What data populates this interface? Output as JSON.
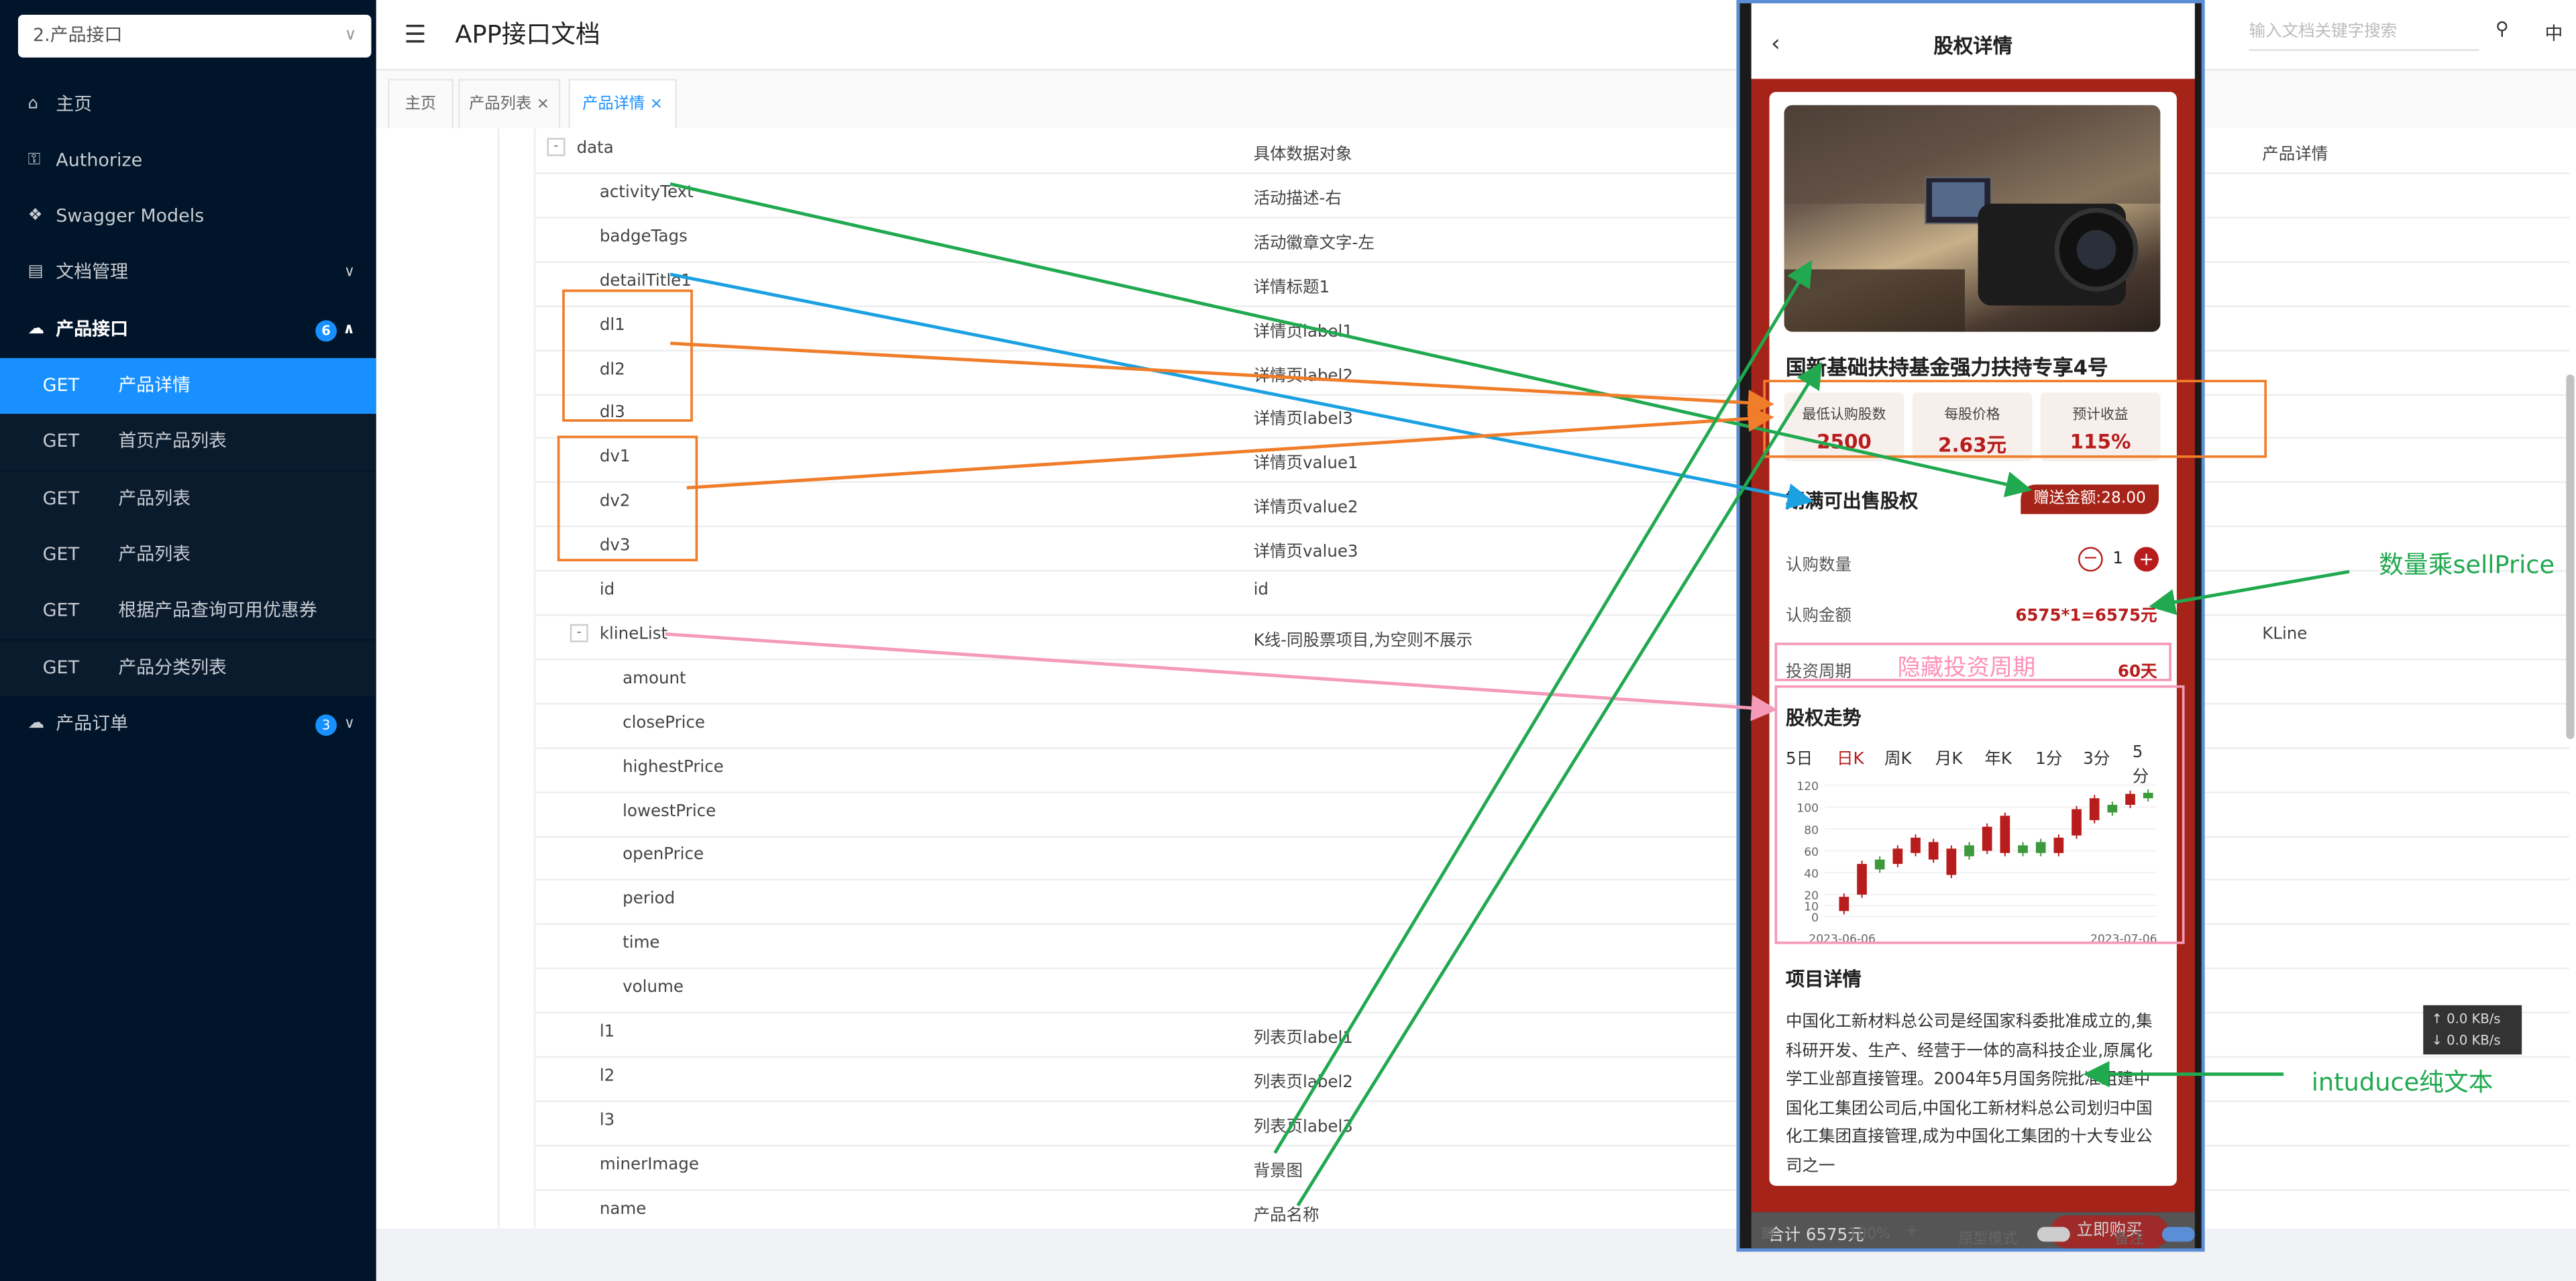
{
  "sidebar": {
    "select_value": "2.产品接口",
    "items": [
      {
        "icon": "home-icon",
        "glyph": "⌂",
        "label": "主页"
      },
      {
        "icon": "lock-icon",
        "glyph": "⚿",
        "label": "Authorize"
      },
      {
        "icon": "cube-icon",
        "glyph": "❖",
        "label": "Swagger Models"
      },
      {
        "icon": "doc-icon",
        "glyph": "▤",
        "label": "文档管理"
      }
    ],
    "group_products": {
      "label": "产品接口",
      "badge": "6"
    },
    "endpoints": [
      {
        "method": "GET",
        "label": "产品详情"
      },
      {
        "method": "GET",
        "label": "首页产品列表"
      },
      {
        "method": "GET",
        "label": "产品列表"
      },
      {
        "method": "GET",
        "label": "产品列表"
      },
      {
        "method": "GET",
        "label": "根据产品查询可用优惠券"
      },
      {
        "method": "GET",
        "label": "产品分类列表"
      }
    ],
    "group_orders": {
      "label": "产品订单",
      "badge": "3"
    }
  },
  "header": {
    "title": "APP接口文档",
    "search_placeholder": "输入文档关键字搜索",
    "lang": "中"
  },
  "tabs": [
    "主页",
    "产品列表",
    "产品详情"
  ],
  "table": {
    "extra_data": "产品详情",
    "extra_kline": "KLine",
    "rows": [
      {
        "name": "data",
        "desc": "具体数据对象",
        "indent": 0
      },
      {
        "name": "activityText",
        "desc": "活动描述-右",
        "indent": 1
      },
      {
        "name": "badgeTags",
        "desc": "活动徽章文字-左",
        "indent": 1
      },
      {
        "name": "detailTitle1",
        "desc": "详情标题1",
        "indent": 1
      },
      {
        "name": "dl1",
        "desc": "详情页label1",
        "indent": 1
      },
      {
        "name": "dl2",
        "desc": "详情页label2",
        "indent": 1
      },
      {
        "name": "dl3",
        "desc": "详情页label3",
        "indent": 1
      },
      {
        "name": "dv1",
        "desc": "详情页value1",
        "indent": 1
      },
      {
        "name": "dv2",
        "desc": "详情页value2",
        "indent": 1
      },
      {
        "name": "dv3",
        "desc": "详情页value3",
        "indent": 1
      },
      {
        "name": "id",
        "desc": "id",
        "indent": 1
      },
      {
        "name": "klineList",
        "desc": "K线-同股票项目,为空则不展示",
        "indent": 1
      },
      {
        "name": "amount",
        "desc": "",
        "indent": 2
      },
      {
        "name": "closePrice",
        "desc": "",
        "indent": 2
      },
      {
        "name": "highestPrice",
        "desc": "",
        "indent": 2
      },
      {
        "name": "lowestPrice",
        "desc": "",
        "indent": 2
      },
      {
        "name": "openPrice",
        "desc": "",
        "indent": 2
      },
      {
        "name": "period",
        "desc": "",
        "indent": 2
      },
      {
        "name": "time",
        "desc": "",
        "indent": 2
      },
      {
        "name": "volume",
        "desc": "",
        "indent": 2
      },
      {
        "name": "l1",
        "desc": "列表页label1",
        "indent": 1
      },
      {
        "name": "l2",
        "desc": "列表页label2",
        "indent": 1
      },
      {
        "name": "l3",
        "desc": "列表页label3",
        "indent": 1
      },
      {
        "name": "minerImage",
        "desc": "背景图",
        "indent": 1
      },
      {
        "name": "name",
        "desc": "产品名称",
        "indent": 1
      }
    ]
  },
  "phone": {
    "title": "股权详情",
    "product_title": "国新基础扶持基金强力扶持专享4号",
    "stats": [
      {
        "label": "最低认购股数",
        "value": "2500"
      },
      {
        "label": "每股价格",
        "value": "2.63元"
      },
      {
        "label": "预计收益",
        "value": "115%"
      }
    ],
    "section_sellable": "期满可出售股权",
    "gift": "赠送金额:28.00",
    "qty_label": "认购数量",
    "qty_value": "1",
    "amount_label": "认购金额",
    "amount_value": "6575*1=6575元",
    "period_label": "投资周期",
    "period_value": "60天",
    "trend_title": "股权走势",
    "kline_tabs": [
      "5日",
      "日K",
      "周K",
      "月K",
      "年K",
      "1分",
      "3分",
      "5分"
    ],
    "intro_title": "项目详情",
    "intro_text": "中国化工新材料总公司是经国家科委批准成立的,集科研开发、生产、经营于一体的高科技企业,原属化学工业部直接管理。2004年5月国务院批准组建中国化工集团公司后,中国化工新材料总公司划归中国化工集团直接管理,成为中国化工集团的十大专业公司之一",
    "total": "合计 6575元",
    "buy_label": "立即购买"
  },
  "statusbar": {
    "zoom": "100%",
    "mode": "原型模式",
    "note": "备注"
  },
  "speed": {
    "up": "↑ 0.0 KB/s",
    "down": "↓ 0.0 KB/s"
  },
  "annotations": {
    "qty_note": "数量乘sellPrice",
    "intro_note": "intuduce纯文本",
    "hide_period": "隐藏投资周期"
  },
  "chart_data": {
    "type": "candlestick",
    "title": "",
    "x_start_label": "2023-06-06",
    "x_end_label": "2023-07-06",
    "ylim": [
      0,
      120
    ],
    "y_ticks": [
      0,
      10,
      20,
      40,
      60,
      80,
      100,
      120
    ],
    "candles": [
      {
        "open": 5,
        "close": 18,
        "up": false
      },
      {
        "open": 20,
        "close": 48,
        "up": false
      },
      {
        "open": 43,
        "close": 52,
        "up": true
      },
      {
        "open": 48,
        "close": 62,
        "up": false
      },
      {
        "open": 58,
        "close": 72,
        "up": false
      },
      {
        "open": 52,
        "close": 68,
        "up": false
      },
      {
        "open": 38,
        "close": 62,
        "up": false
      },
      {
        "open": 55,
        "close": 65,
        "up": true
      },
      {
        "open": 60,
        "close": 82,
        "up": false
      },
      {
        "open": 58,
        "close": 92,
        "up": false
      },
      {
        "open": 58,
        "close": 65,
        "up": true
      },
      {
        "open": 58,
        "close": 68,
        "up": true
      },
      {
        "open": 58,
        "close": 72,
        "up": false
      },
      {
        "open": 74,
        "close": 98,
        "up": false
      },
      {
        "open": 88,
        "close": 108,
        "up": false
      },
      {
        "open": 95,
        "close": 102,
        "up": true
      },
      {
        "open": 102,
        "close": 112,
        "up": false
      },
      {
        "open": 108,
        "close": 113,
        "up": true
      }
    ]
  }
}
